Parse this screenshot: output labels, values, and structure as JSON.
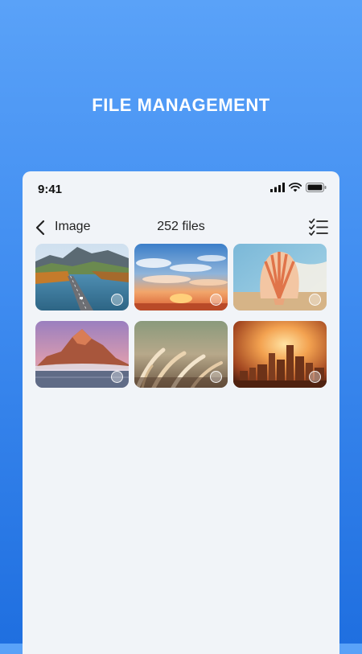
{
  "promo": {
    "title": "FILE MANAGEMENT"
  },
  "status_bar": {
    "time": "9:41",
    "icons": [
      "signal-icon",
      "wifi-icon",
      "battery-icon"
    ]
  },
  "header": {
    "back_icon": "chevron-left-icon",
    "title": "Image",
    "count": "252 files",
    "select_icon": "checklist-icon"
  },
  "images": [
    {
      "name": "mountain-lake-road"
    },
    {
      "name": "sunset-clouds"
    },
    {
      "name": "seashell-beach"
    },
    {
      "name": "mountain-peak-mist"
    },
    {
      "name": "pampas-grass"
    },
    {
      "name": "city-skyline-sunset"
    }
  ],
  "colors": {
    "background_top": "#5aa2f8",
    "background_bottom": "#1f6fe0",
    "panel": "#f1f4f8"
  }
}
